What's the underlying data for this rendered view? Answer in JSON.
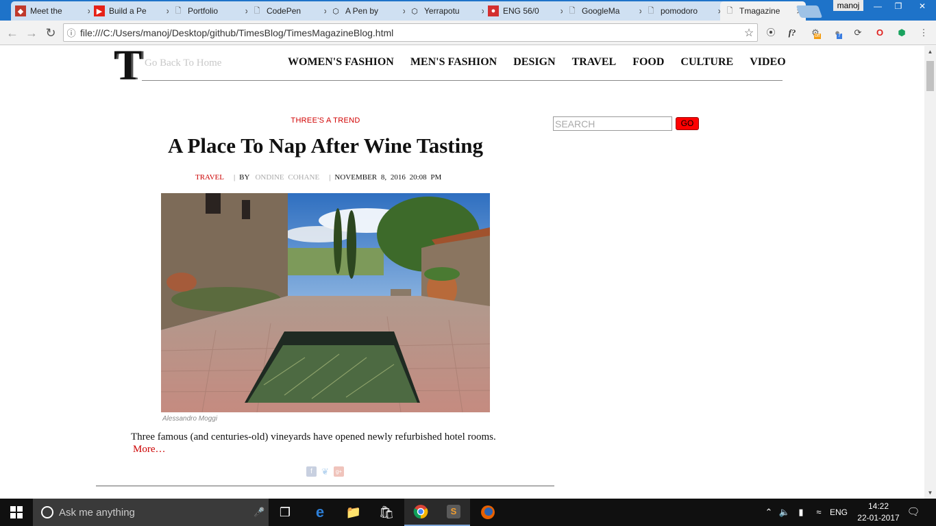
{
  "browser": {
    "tabs": [
      {
        "title": "Meet the",
        "icon": "codepen-red-icon"
      },
      {
        "title": "Build a Pe",
        "icon": "youtube-icon"
      },
      {
        "title": "Portfolio",
        "icon": "page-icon"
      },
      {
        "title": "CodePen",
        "icon": "page-icon"
      },
      {
        "title": "A Pen by",
        "icon": "codepen-icon"
      },
      {
        "title": "Yerrapotu",
        "icon": "codepen-icon"
      },
      {
        "title": "ENG 56/0",
        "icon": "cricket-icon"
      },
      {
        "title": "GoogleMa",
        "icon": "page-icon"
      },
      {
        "title": "pomodoro",
        "icon": "page-icon"
      },
      {
        "title": "Tmagazine",
        "icon": "page-icon",
        "active": true
      }
    ],
    "profile_name": "manoj",
    "url": "file:///C:/Users/manoj/Desktop/github/TimesBlog/TimesMagazineBlog.html",
    "extension_badges": {
      "off": "off",
      "count": "7"
    }
  },
  "site": {
    "logo_letter": "T",
    "home_link": "Go Back To Home",
    "nav": [
      "WOMEN'S FASHION",
      "MEN'S FASHION",
      "DESIGN",
      "TRAVEL",
      "FOOD",
      "CULTURE",
      "VIDEO"
    ]
  },
  "article": {
    "kicker": "THREE'S A TREND",
    "headline": "A Place To Nap After Wine Tasting",
    "section": "TRAVEL",
    "by_label": "BY",
    "author": "ONDINE COHANE",
    "date": "NOVEMBER 8, 2016 20:08 PM",
    "photo_caption": "Alessandro Moggi",
    "summary": "Three famous (and centuries-old) vineyards have opened newly refurbished hotel rooms.",
    "more_link": "More…"
  },
  "sidebar": {
    "search_placeholder": "SEARCH",
    "go_label": "GO"
  },
  "taskbar": {
    "search_text": "Ask me anything",
    "language": "ENG",
    "time": "14:22",
    "date": "22-01-2017"
  },
  "colors": {
    "accent_red": "#d10000",
    "chrome_blue": "#1e73c9"
  }
}
